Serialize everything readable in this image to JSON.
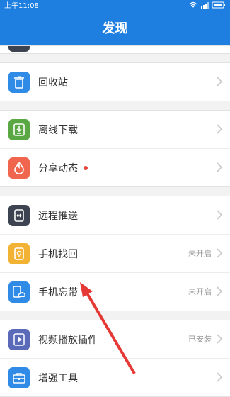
{
  "status_bar": {
    "time": "上午11:08"
  },
  "header": {
    "title": "发现"
  },
  "groups": [
    {
      "items": [
        {
          "label": "回收站"
        }
      ]
    },
    {
      "items": [
        {
          "label": "离线下载"
        },
        {
          "label": "分享动态"
        }
      ]
    },
    {
      "items": [
        {
          "label": "远程推送",
          "status": ""
        },
        {
          "label": "手机找回",
          "status": "未开启"
        },
        {
          "label": "手机忘带",
          "status": "未开启"
        }
      ]
    },
    {
      "items": [
        {
          "label": "视频播放插件",
          "status": "已安装"
        },
        {
          "label": "增强工具",
          "status": ""
        }
      ]
    }
  ],
  "colors": {
    "primary": "#1e7fe0",
    "recycle_icon": "#2f8be6",
    "offline_icon": "#5aa844",
    "share_icon": "#f0654e",
    "remote_icon": "#3d4350",
    "find_icon": "#f2b233",
    "forgot_icon": "#2f8be6",
    "video_icon": "#5a6ab8",
    "tools_icon": "#2f8be6",
    "badge": "#e8463a",
    "arrow": "#e53935"
  }
}
